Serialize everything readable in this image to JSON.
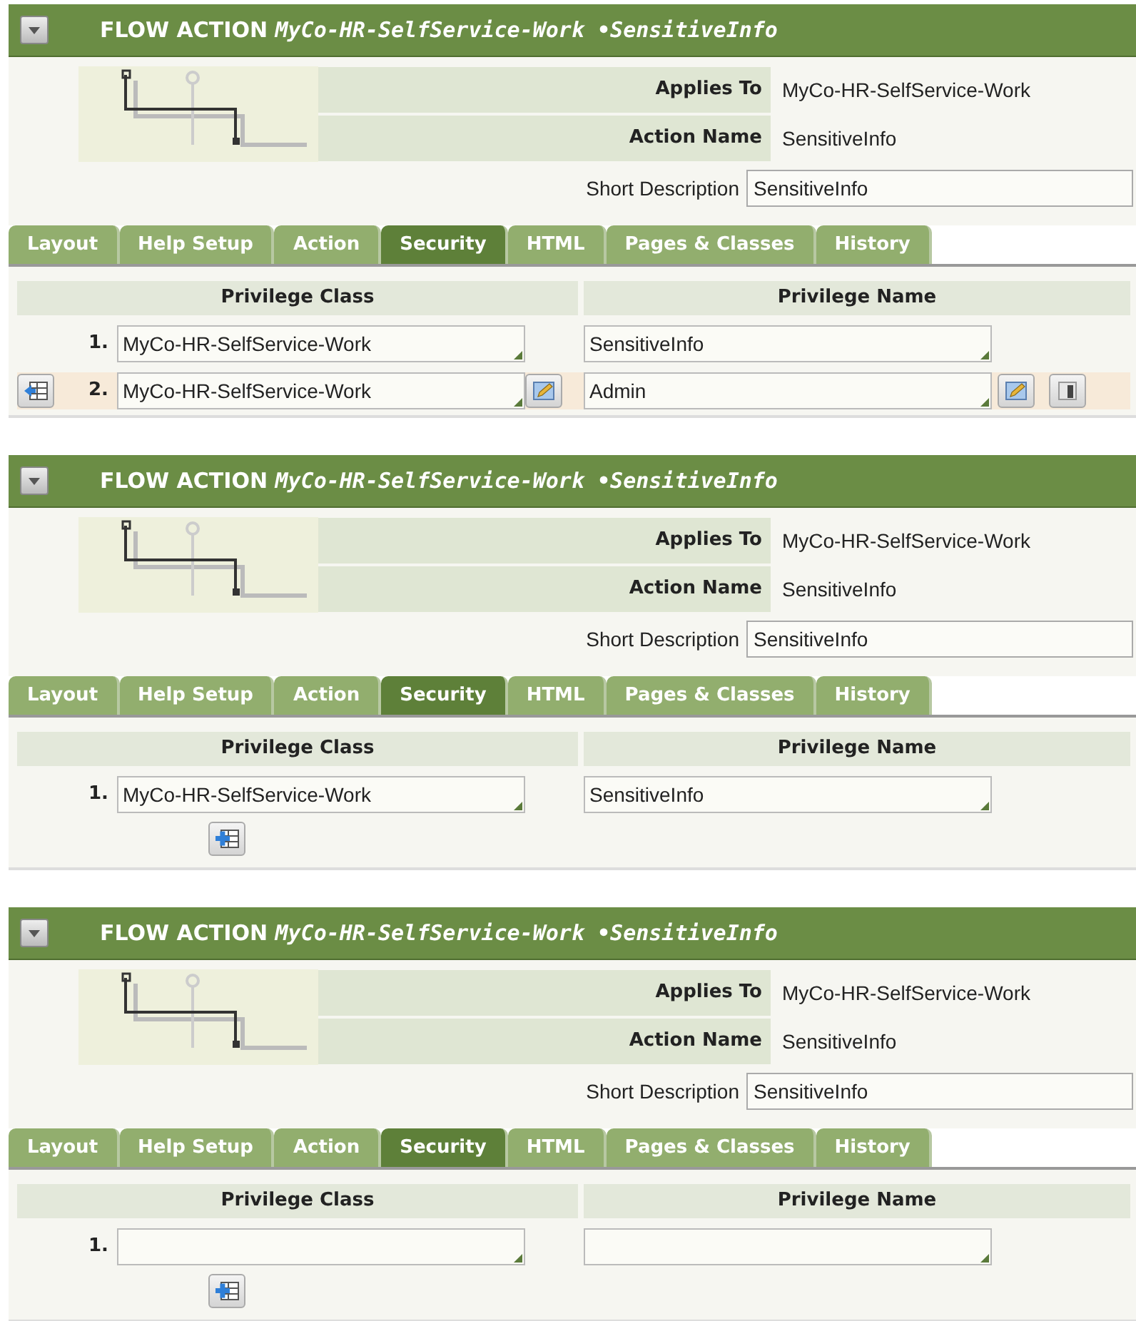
{
  "panels": [
    {
      "header": {
        "title": "FLOW ACTION *MyCo-HR-SelfService-Work •SensitiveInfo*"
      },
      "applies_to": {
        "label": "Applies To",
        "value": "MyCo-HR-SelfService-Work"
      },
      "action_name": {
        "label": "Action Name",
        "value": "SensitiveInfo"
      },
      "short_description": {
        "label": "Short Description",
        "value": "SensitiveInfo"
      },
      "tabs": [
        {
          "label": "Layout",
          "selected": false
        },
        {
          "label": "Help Setup",
          "selected": false
        },
        {
          "label": "Action",
          "selected": false
        },
        {
          "label": "Security",
          "selected": true
        },
        {
          "label": "HTML",
          "selected": false
        },
        {
          "label": "Pages & Classes",
          "selected": false
        },
        {
          "label": "History",
          "selected": false
        }
      ],
      "table": {
        "columns": [
          "Privilege Class",
          "Privilege Name"
        ],
        "rows": [
          {
            "number": "1.",
            "privilege_class": "MyCo-HR-SelfService-Work",
            "privilege_name": "SensitiveInfo",
            "selected": false
          },
          {
            "number": "2.",
            "privilege_class": "MyCo-HR-SelfService-Work",
            "privilege_name": "Admin",
            "selected": true
          }
        ]
      },
      "add_row_button": false
    },
    {
      "header": {
        "title": "FLOW ACTION *MyCo-HR-SelfService-Work •SensitiveInfo*"
      },
      "applies_to": {
        "label": "Applies To",
        "value": "MyCo-HR-SelfService-Work"
      },
      "action_name": {
        "label": "Action Name",
        "value": "SensitiveInfo"
      },
      "short_description": {
        "label": "Short Description",
        "value": "SensitiveInfo"
      },
      "tabs": [
        {
          "label": "Layout",
          "selected": false
        },
        {
          "label": "Help Setup",
          "selected": false
        },
        {
          "label": "Action",
          "selected": false
        },
        {
          "label": "Security",
          "selected": true
        },
        {
          "label": "HTML",
          "selected": false
        },
        {
          "label": "Pages & Classes",
          "selected": false
        },
        {
          "label": "History",
          "selected": false
        }
      ],
      "table": {
        "columns": [
          "Privilege Class",
          "Privilege Name"
        ],
        "rows": [
          {
            "number": "1.",
            "privilege_class": "MyCo-HR-SelfService-Work",
            "privilege_name": "SensitiveInfo",
            "selected": false
          }
        ]
      },
      "add_row_button": true
    },
    {
      "header": {
        "title": "FLOW ACTION *MyCo-HR-SelfService-Work •SensitiveInfo*"
      },
      "applies_to": {
        "label": "Applies To",
        "value": "MyCo-HR-SelfService-Work"
      },
      "action_name": {
        "label": "Action Name",
        "value": "SensitiveInfo"
      },
      "short_description": {
        "label": "Short Description",
        "value": "SensitiveInfo"
      },
      "tabs": [
        {
          "label": "Layout",
          "selected": false
        },
        {
          "label": "Help Setup",
          "selected": false
        },
        {
          "label": "Action",
          "selected": false
        },
        {
          "label": "Security",
          "selected": true
        },
        {
          "label": "HTML",
          "selected": false
        },
        {
          "label": "Pages & Classes",
          "selected": false
        },
        {
          "label": "History",
          "selected": false
        }
      ],
      "table": {
        "columns": [
          "Privilege Class",
          "Privilege Name"
        ],
        "rows": [
          {
            "number": "1.",
            "privilege_class": "",
            "privilege_name": "",
            "selected": false
          }
        ]
      },
      "add_row_button": true
    }
  ]
}
